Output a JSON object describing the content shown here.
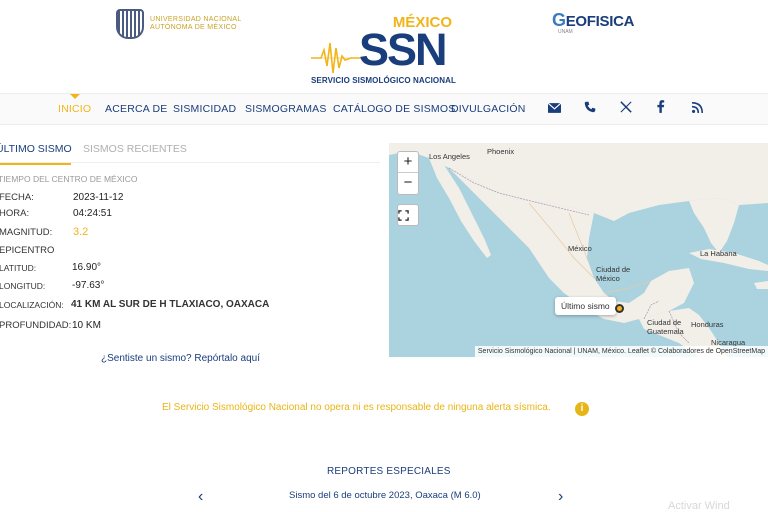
{
  "header": {
    "unam_line1": "UNIVERSIDAD NACIONAL",
    "unam_line2": "AUTÓNOMA DE MÉXICO",
    "ssn_country": "MÉXICO",
    "ssn_acronym": "SSN",
    "ssn_name": "SERVICIO SISMOLÓGICO NACIONAL",
    "geo_letter": "G",
    "geo_name": "EOFISICA",
    "geo_sub": "UNAM"
  },
  "nav": {
    "items": [
      "INICIO",
      "ACERCA DE",
      "SISMICIDAD",
      "SISMOGRAMAS",
      "CATÁLOGO DE SISMOS",
      "DIVULGACIÓN"
    ],
    "icons": [
      "envelope-icon",
      "phone-icon",
      "x-icon",
      "facebook-icon",
      "rss-icon"
    ]
  },
  "tabs": {
    "active": "ÚLTIMO SISMO",
    "inactive": "SISMOS RECIENTES"
  },
  "quake": {
    "timezone": "TIEMPO DEL CENTRO DE MÉXICO",
    "fecha_label": "FECHA:",
    "fecha": "2023-11-12",
    "hora_label": "HORA:",
    "hora": "04:24:51",
    "magnitud_label": "MAGNITUD:",
    "magnitud": "3.2",
    "epicentro_label": "EPICENTRO",
    "latitud_label": "LATITUD:",
    "latitud": "16.90°",
    "longitud_label": "LONGITUD:",
    "longitud": "-97.63°",
    "localizacion_label": "LOCALIZACIÓN:",
    "localizacion": "41 KM AL SUR DE H TLAXIACO, OAXACA",
    "profundidad_label": "PROFUNDIDAD:",
    "profundidad": "10 KM",
    "report_link": "¿Sentiste un sismo? Repórtalo aquí"
  },
  "map": {
    "zoom_in": "+",
    "zoom_out": "−",
    "popup": "Último sismo",
    "attribution": "Servicio Sismológico Nacional | UNAM, México. Leaflet © Colaboradores de OpenStreetMap",
    "labels": [
      "Los Angeles",
      "Phoenix",
      "México",
      "Ciudad de México",
      "La Habana",
      "Ciudad de Guatemala",
      "Honduras",
      "Nicaragua"
    ]
  },
  "notice": {
    "text": "El Servicio Sismológico Nacional no opera ni es responsable de ninguna alerta sísmica.",
    "icon": "i"
  },
  "reports": {
    "title": "REPORTES ESPECIALES",
    "item": "Sismo del 6 de octubre 2023, Oaxaca (M 6.0)",
    "prev": "‹",
    "next": "›"
  },
  "watermark": "Activar Wind",
  "colors": {
    "brand_blue": "#1a3d7c",
    "accent_gold": "#f2b418",
    "water": "#aad3df",
    "land": "#f2efe9"
  }
}
